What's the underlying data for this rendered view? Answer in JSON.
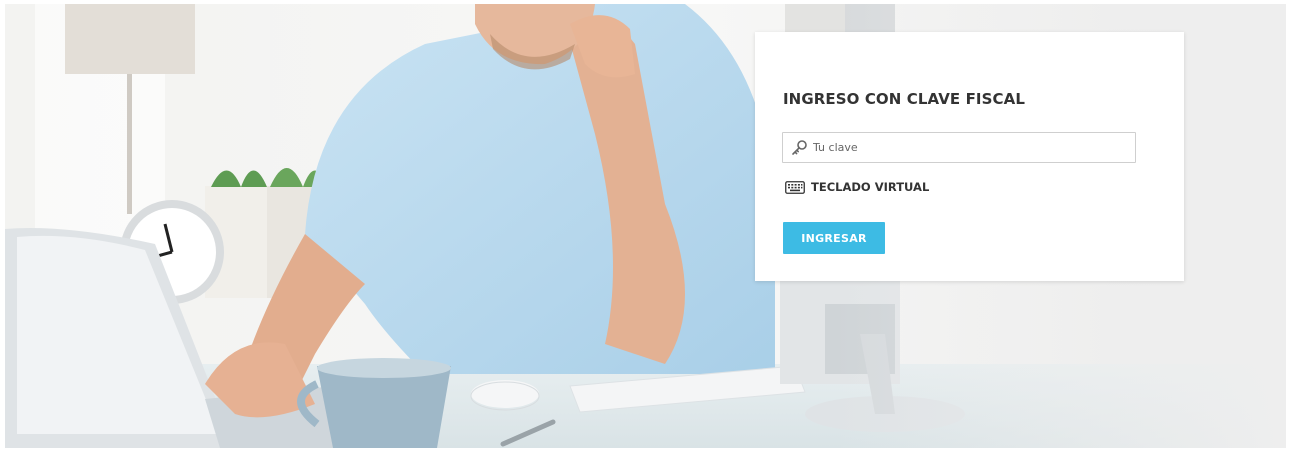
{
  "login": {
    "title": "INGRESO CON CLAVE FISCAL",
    "password_placeholder": "Tu clave",
    "password_value": "",
    "virtual_keyboard_label": "TECLADO VIRTUAL",
    "submit_label": "INGRESAR"
  },
  "icons": {
    "password": "key-icon",
    "virtual_keyboard": "keyboard-icon"
  },
  "colors": {
    "accent_button": "#3dbbe4",
    "title_text": "#333333",
    "card_background": "#ffffff"
  }
}
